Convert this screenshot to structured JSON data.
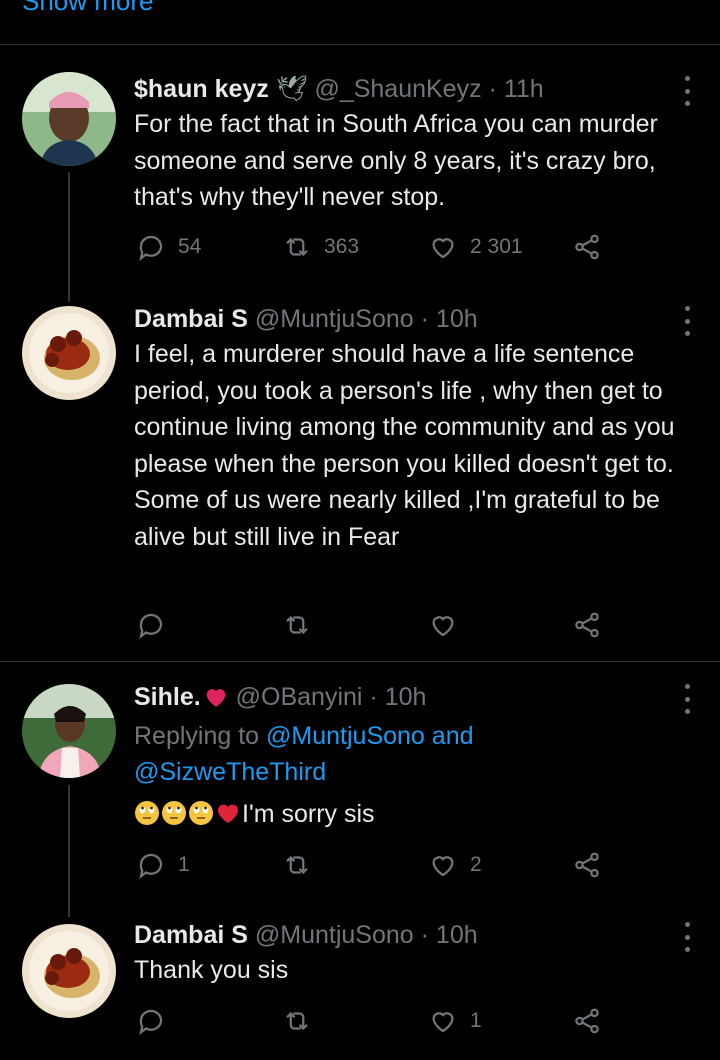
{
  "top": {
    "show_more": "Show more"
  },
  "tweets": [
    {
      "display_name": "$haun keyz",
      "handle": "@_ShaunKeyz",
      "time": "· 11h",
      "text": "For the fact that in South Africa you can murder someone and serve only 8 years, it's crazy bro, that's why they'll never stop.",
      "reply_count": "54",
      "retweet_count": "363",
      "like_count": "2 301"
    },
    {
      "display_name": "Dambai S",
      "handle": "@MuntjuSono",
      "time": "· 10h",
      "text": "I feel, a murderer should have a life sentence period, you took a person's life , why then get to continue living among the community and as you please when the person you killed doesn't get to. Some of us were nearly killed ,I'm grateful to be alive but still live in Fear",
      "reply_count": "",
      "retweet_count": "",
      "like_count": ""
    },
    {
      "display_name": "Sihle.",
      "handle": "@OBanyini",
      "time": "· 10h",
      "replying_prefix": "Replying to",
      "replying_user1": "@MuntjuSono",
      "replying_and": "and",
      "replying_user2": "@SizweTheThird",
      "text": "I'm sorry sis",
      "reply_count": "1",
      "retweet_count": "",
      "like_count": "2"
    },
    {
      "display_name": "Dambai S",
      "handle": "@MuntjuSono",
      "time": "· 10h",
      "text": "Thank you sis",
      "reply_count": "",
      "retweet_count": "",
      "like_count": "1"
    }
  ],
  "colors": {
    "background": "#000000",
    "text": "#e7e9ea",
    "muted": "#71767b",
    "link": "#1d9bf0",
    "divider": "#2f3336",
    "heart": "#e0245e"
  }
}
